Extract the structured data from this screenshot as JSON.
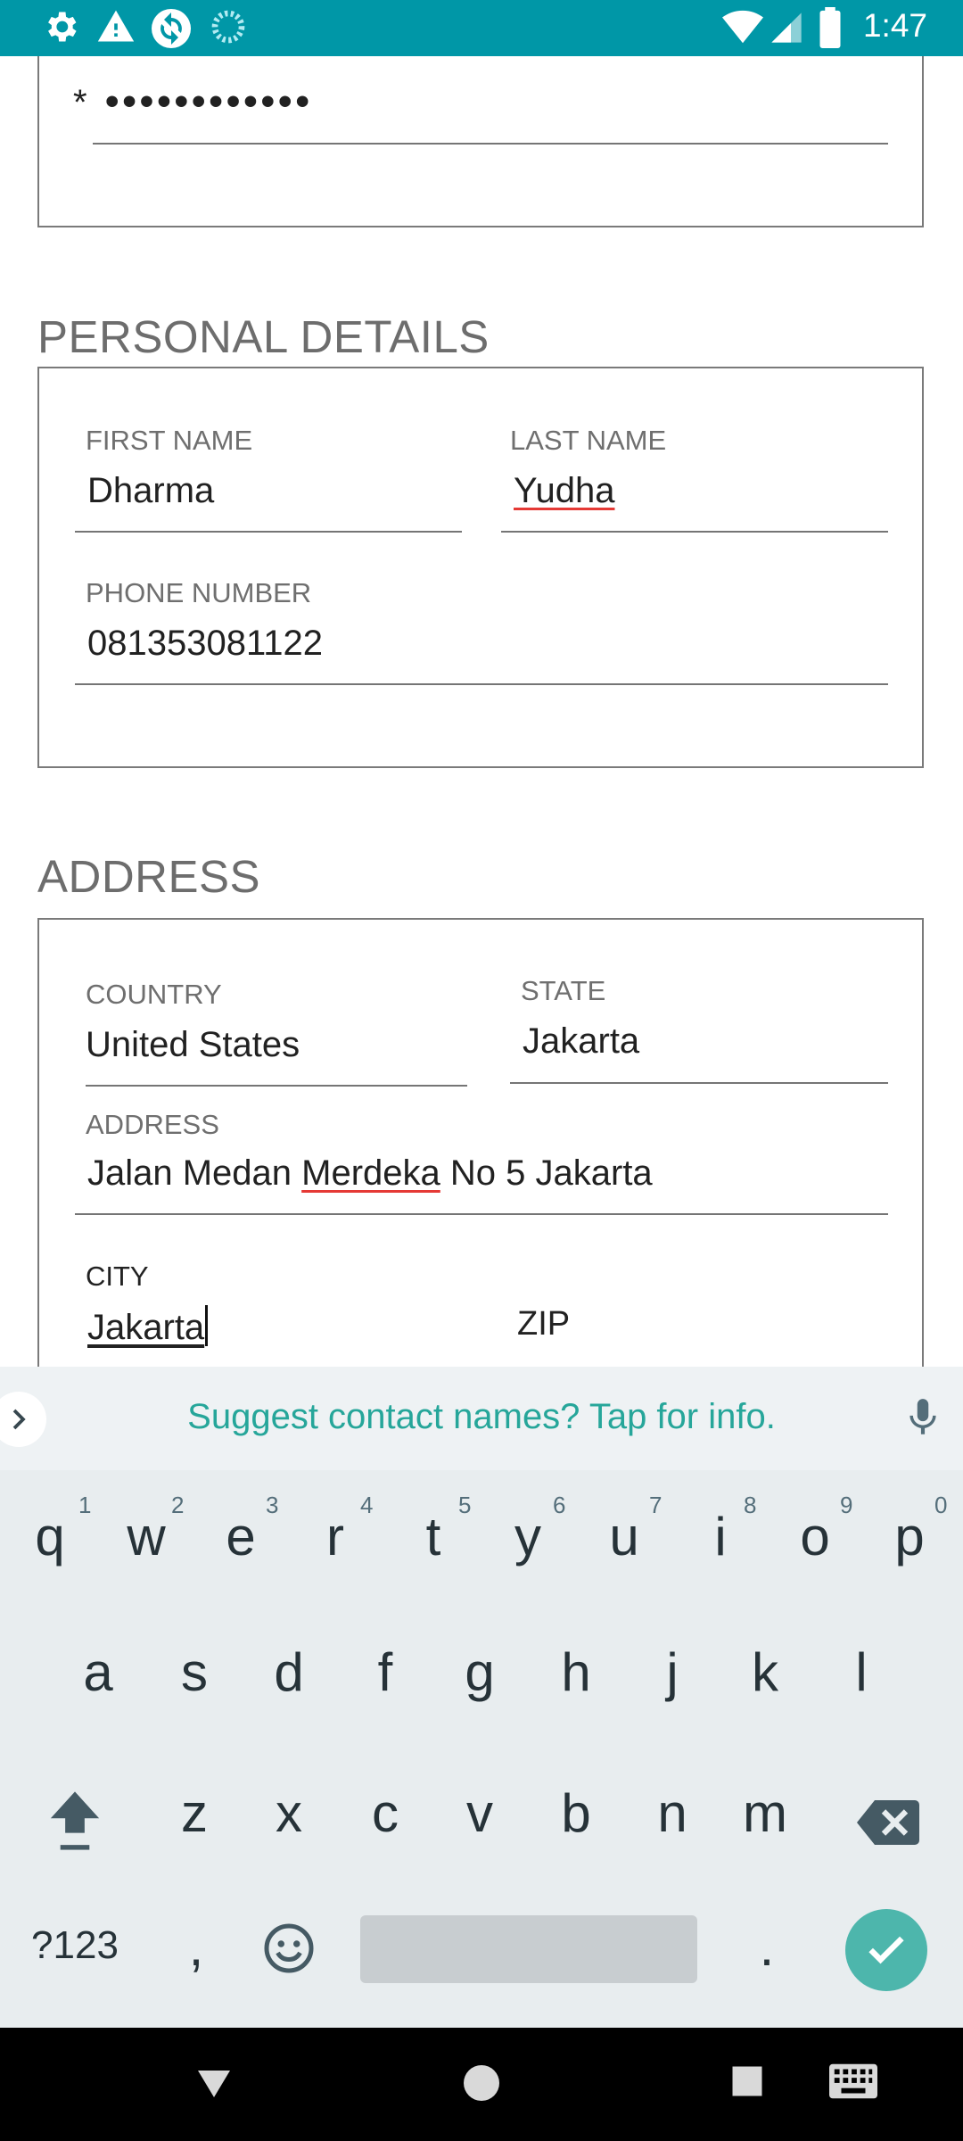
{
  "status_bar": {
    "time": "1:47",
    "left_icons": [
      "gear-icon",
      "warning-icon",
      "sync-icon",
      "loading-icon"
    ],
    "right_icons": [
      "wifi-icon",
      "signal-icon",
      "battery-icon"
    ],
    "background_color": "#0097a7"
  },
  "form": {
    "password_field": {
      "asterisk": "*",
      "value": "••••••••••••"
    },
    "personal_details": {
      "title": "PERSONAL DETAILS",
      "first_name": {
        "label": "FIRST NAME",
        "value": "Dharma"
      },
      "last_name": {
        "label": "LAST NAME",
        "value": "Yudha"
      },
      "phone": {
        "label": "PHONE NUMBER",
        "value": "081353081122"
      }
    },
    "address": {
      "title": "ADDRESS",
      "country": {
        "label": "COUNTRY",
        "value": "United States"
      },
      "state": {
        "label": "STATE",
        "value": "Jakarta"
      },
      "address": {
        "label": "ADDRESS",
        "value_before": "Jalan Medan ",
        "value_misspelled": "Merdeka",
        "value_after": " No 5 Jakarta"
      },
      "city": {
        "label": "CITY",
        "value": "Jakarta"
      },
      "zip": {
        "label": "ZIP"
      }
    }
  },
  "suggestion_bar": {
    "text": "Suggest contact names? Tap for info.",
    "accent_color": "#26a69a"
  },
  "keyboard": {
    "row1": [
      "q",
      "w",
      "e",
      "r",
      "t",
      "y",
      "u",
      "i",
      "o",
      "p"
    ],
    "row1_hints": [
      "1",
      "2",
      "3",
      "4",
      "5",
      "6",
      "7",
      "8",
      "9",
      "0"
    ],
    "row2": [
      "a",
      "s",
      "d",
      "f",
      "g",
      "h",
      "j",
      "k",
      "l"
    ],
    "row3": [
      "z",
      "x",
      "c",
      "v",
      "b",
      "n",
      "m"
    ],
    "symbols_label": "?123",
    "comma": ",",
    "period": ".",
    "enter_color": "#4db6ac"
  },
  "nav_bar": {
    "buttons": [
      "back-icon",
      "home-icon",
      "recents-icon",
      "keyboard-switch-icon"
    ]
  }
}
